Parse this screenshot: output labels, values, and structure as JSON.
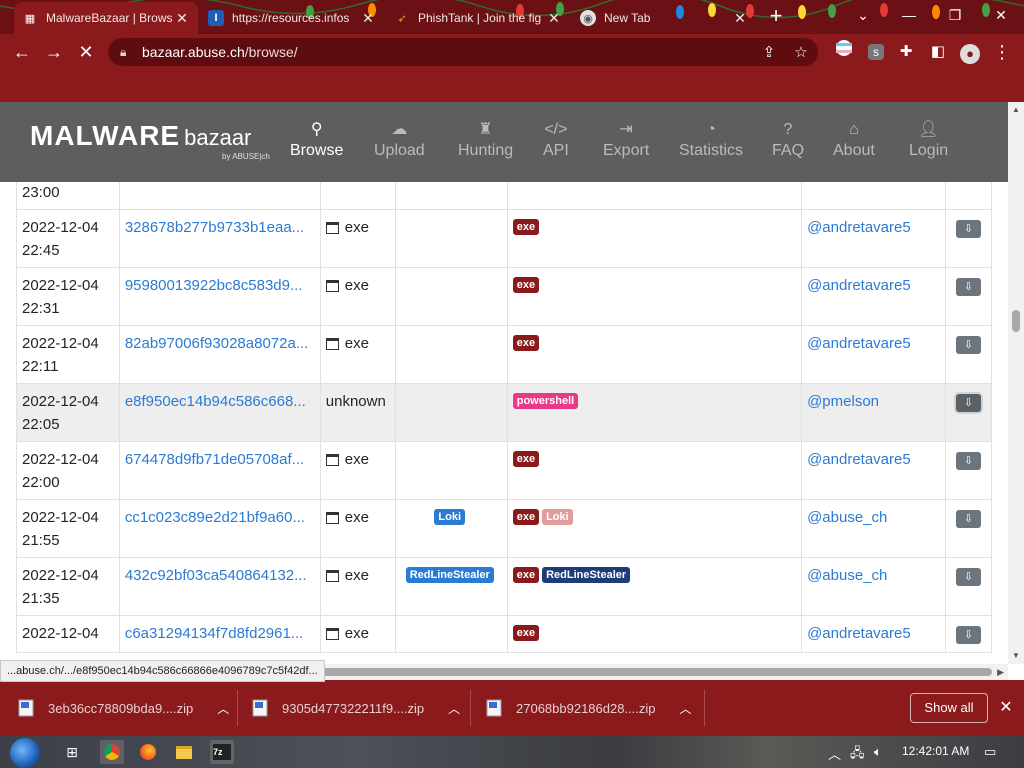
{
  "browser": {
    "tabs": [
      {
        "title": "MalwareBazaar | Brows",
        "favicon": "bazaar-favicon",
        "active": true
      },
      {
        "title": "https://resources.infos",
        "favicon": "infosec-favicon"
      },
      {
        "title": "PhishTank | Join the fig",
        "favicon": "phishtank-favicon"
      },
      {
        "title": "New Tab",
        "favicon": "chrome-favicon"
      }
    ],
    "url_domain": "bazaar.abuse.ch",
    "url_path": "/browse/",
    "status_url": "...abuse.ch/.../e8f950ec14b94c586c66866e4096789c7c5f42df..."
  },
  "site": {
    "logo_main": "MALWARE",
    "logo_sub": "bazaar",
    "logo_by": "by ABUSE|ch",
    "nav": [
      {
        "label": "Browse",
        "icon": "search-icon",
        "active": true
      },
      {
        "label": "Upload",
        "icon": "cloud-upload-icon"
      },
      {
        "label": "Hunting",
        "icon": "hunting-icon"
      },
      {
        "label": "API",
        "icon": "code-icon"
      },
      {
        "label": "Export",
        "icon": "file-export-icon"
      },
      {
        "label": "Statistics",
        "icon": "pie-chart-icon"
      },
      {
        "label": "FAQ",
        "icon": "question-circle-icon"
      },
      {
        "label": "About",
        "icon": "building-icon"
      },
      {
        "label": "Login",
        "icon": "user-icon"
      }
    ]
  },
  "table": {
    "rows": [
      {
        "date": "",
        "time": "23:00",
        "hash": "",
        "type": "",
        "sig": [],
        "tags": [],
        "reporter": ""
      },
      {
        "date": "2022-12-04",
        "time": "22:45",
        "hash": "328678b277b9733b1eaa...",
        "type": "exe",
        "sig": [],
        "tags": [
          "exe"
        ],
        "reporter": "@andretavare5"
      },
      {
        "date": "2022-12-04",
        "time": "22:31",
        "hash": "95980013922bc8c583d9...",
        "type": "exe",
        "sig": [],
        "tags": [
          "exe"
        ],
        "reporter": "@andretavare5"
      },
      {
        "date": "2022-12-04",
        "time": "22:11",
        "hash": "82ab97006f93028a8072a...",
        "type": "exe",
        "sig": [],
        "tags": [
          "exe"
        ],
        "reporter": "@andretavare5"
      },
      {
        "date": "2022-12-04",
        "time": "22:05",
        "hash": "e8f950ec14b94c586c668...",
        "type": "unknown",
        "sig": [],
        "tags": [
          "powershell"
        ],
        "reporter": "@pmelson",
        "highlight": true
      },
      {
        "date": "2022-12-04",
        "time": "22:00",
        "hash": "674478d9fb71de05708af...",
        "type": "exe",
        "sig": [],
        "tags": [
          "exe"
        ],
        "reporter": "@andretavare5"
      },
      {
        "date": "2022-12-04",
        "time": "21:55",
        "hash": "cc1c023c89e2d21bf9a60...",
        "type": "exe",
        "sig": [
          "Loki"
        ],
        "tags": [
          "exe",
          "Loki"
        ],
        "reporter": "@abuse_ch"
      },
      {
        "date": "2022-12-04",
        "time": "21:35",
        "hash": "432c92bf03ca540864132...",
        "type": "exe",
        "sig": [
          "RedLineStealer"
        ],
        "tags": [
          "exe",
          "RedLineStealer"
        ],
        "reporter": "@abuse_ch"
      },
      {
        "date": "2022-12-04",
        "time": "",
        "hash": "c6a31294134f7d8fd2961...",
        "type": "exe",
        "sig": [],
        "tags": [
          "exe"
        ],
        "reporter": "@andretavare5"
      }
    ]
  },
  "downloads": [
    {
      "name": "3eb36cc78809bda9....zip"
    },
    {
      "name": "9305d477322211f9....zip"
    },
    {
      "name": "27068bb92186d28....zip"
    }
  ],
  "downloads_show_all": "Show all",
  "taskbar": {
    "clock": "12:42:01 AM"
  },
  "colors": {
    "browser_frame": "#8b1a1c",
    "tabstrip": "#6b1014",
    "site_nav": "#5c5e60",
    "link": "#2a7bd3",
    "tag_exe": "#8b1a1c",
    "tag_powershell": "#e8398a"
  }
}
